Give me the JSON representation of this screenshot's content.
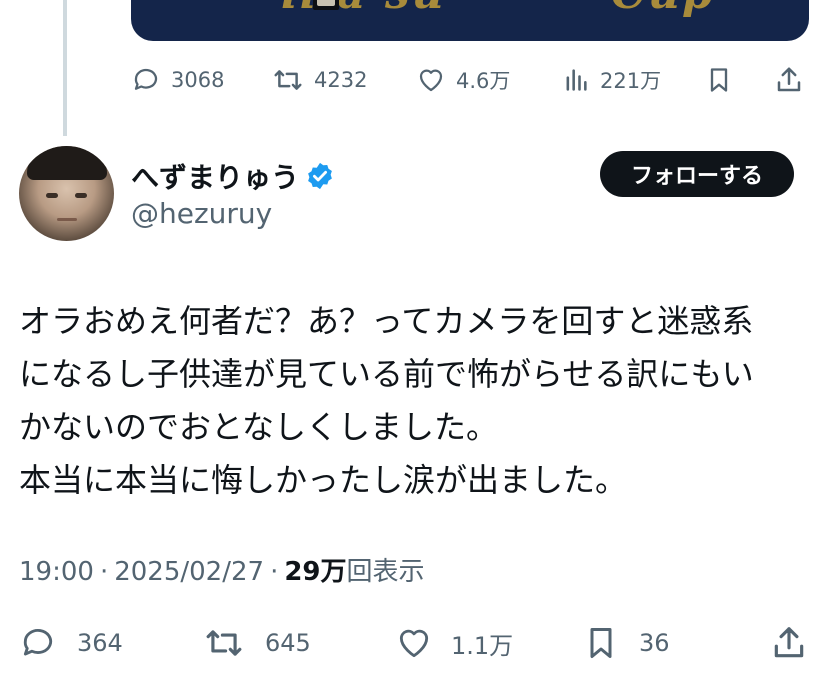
{
  "previous_tweet": {
    "media_text": [
      "ilia su",
      "Cup"
    ],
    "actions": {
      "replies": "3068",
      "reposts": "4232",
      "likes": "4.6万",
      "views": "221万"
    }
  },
  "tweet": {
    "display_name": "へずまりゅう",
    "handle": "@hezuruy",
    "follow_label": "フォローする",
    "body_lines": [
      "オラおめえ何者だ？あ？ってカメラを回すと迷惑系",
      "になるし子供達が見ている前で怖がらせる訳にもい",
      "かないのでおとなしくしました。",
      "本当に本当に悔しかったし涙が出ました。"
    ],
    "time": "19:00",
    "date": "2025/02/27",
    "views_count": "29万",
    "views_label": "回表示",
    "actions": {
      "replies": "364",
      "reposts": "645",
      "likes": "1.1万",
      "bookmarks": "36"
    }
  },
  "colors": {
    "text": "#0f1419",
    "secondary": "#536471",
    "verified": "#1d9bf0",
    "follow_bg": "#0f1419"
  }
}
